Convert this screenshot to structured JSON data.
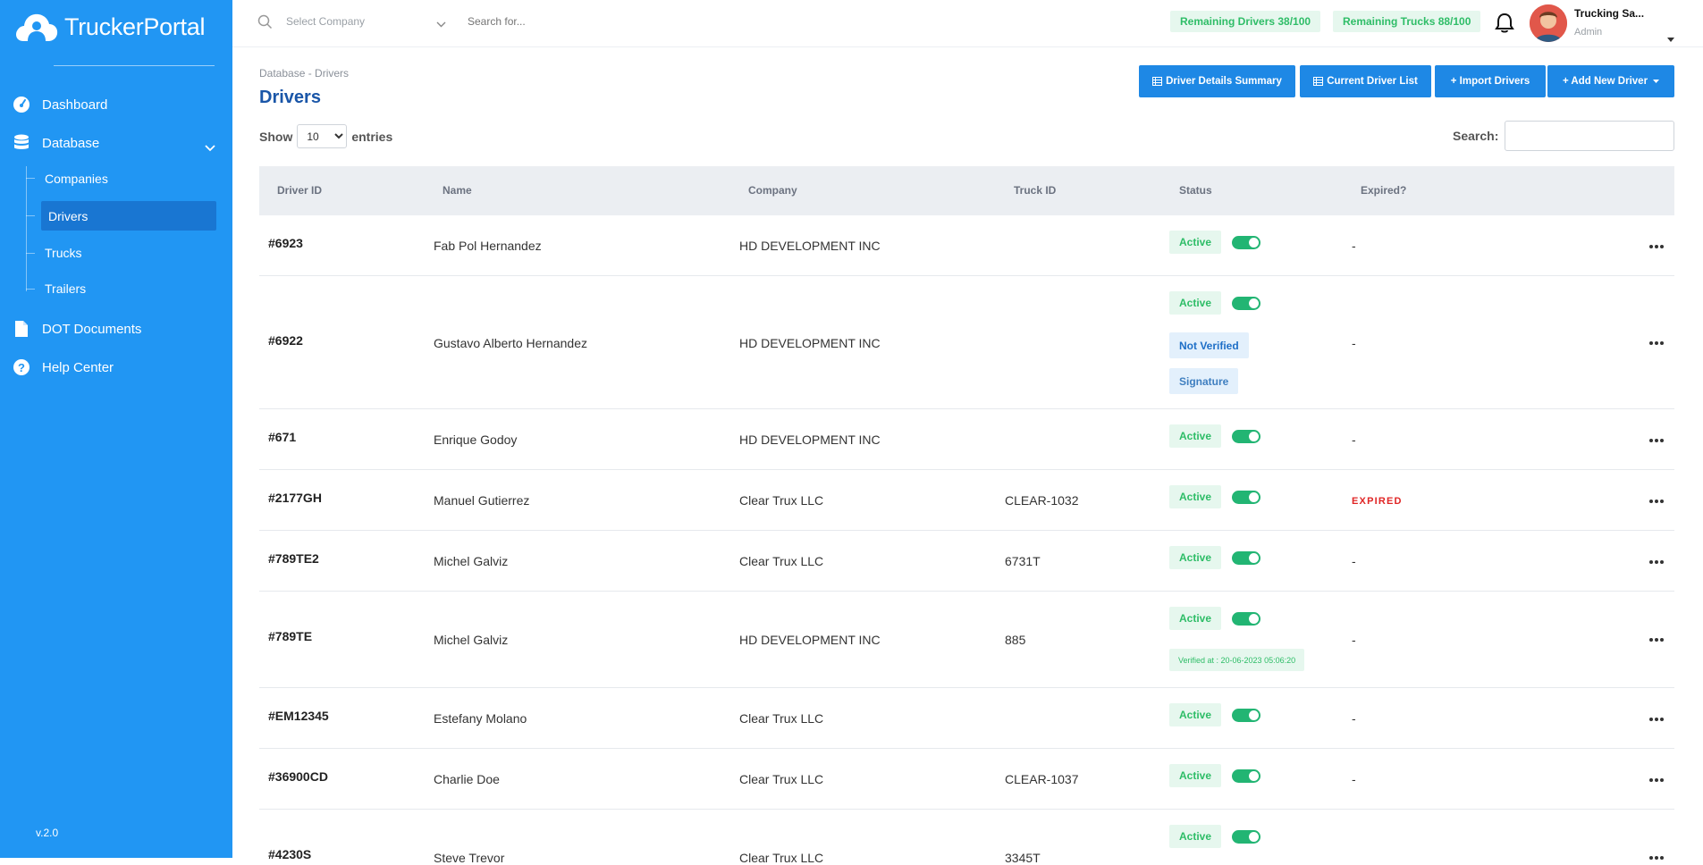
{
  "app": {
    "logo_text": "TruckerPortal",
    "version": "v.2.0"
  },
  "sidebar": {
    "items": [
      {
        "label": "Dashboard",
        "icon": "dashboard-gauge-icon"
      },
      {
        "label": "Database",
        "icon": "database-icon"
      },
      {
        "label": "DOT Documents",
        "icon": "document-icon"
      },
      {
        "label": "Help Center",
        "icon": "help-icon"
      }
    ],
    "subitems": [
      {
        "label": "Companies"
      },
      {
        "label": "Drivers",
        "active": true
      },
      {
        "label": "Trucks"
      },
      {
        "label": "Trailers"
      }
    ]
  },
  "topbar": {
    "select_company_placeholder": "Select Company",
    "search_placeholder": "Search for...",
    "remaining_drivers": "Remaining Drivers 38/100",
    "remaining_trucks": "Remaining Trucks 88/100",
    "user_name": "Trucking Sa...",
    "user_role": "Admin"
  },
  "page": {
    "breadcrumb": "Database - Drivers",
    "title": "Drivers",
    "buttons": {
      "summary": "Driver Details Summary",
      "current": "Current Driver List",
      "import": "+ Import Drivers",
      "add": "+ Add New Driver"
    },
    "show_label": "Show",
    "entries_label": "entries",
    "entries_value": "10",
    "search_label": "Search:"
  },
  "table": {
    "columns": [
      "Driver ID",
      "Name",
      "Company",
      "Truck ID",
      "Status",
      "Expired?"
    ],
    "rows": [
      {
        "id": "#6923",
        "name": "Fab Pol Hernandez",
        "company": "HD DEVELOPMENT INC",
        "truck": "",
        "status": "Active",
        "expired": "-"
      },
      {
        "id": "#6922",
        "name": "Gustavo Alberto Hernandez",
        "company": "HD DEVELOPMENT INC",
        "truck": "",
        "status": "Active",
        "extra1": "Not Verified",
        "extra2": "Signature",
        "expired": "-"
      },
      {
        "id": "#671",
        "name": "Enrique Godoy",
        "company": "HD DEVELOPMENT INC",
        "truck": "",
        "status": "Active",
        "expired": "-"
      },
      {
        "id": "#2177GH",
        "name": "Manuel Gutierrez",
        "company": "Clear Trux LLC",
        "truck": "CLEAR-1032",
        "status": "Active",
        "expired": "EXPIRED"
      },
      {
        "id": "#789TE2",
        "name": "Michel Galviz",
        "company": "Clear Trux LLC",
        "truck": "6731T",
        "status": "Active",
        "expired": "-"
      },
      {
        "id": "#789TE",
        "name": "Michel Galviz",
        "company": "HD DEVELOPMENT INC",
        "truck": "885",
        "status": "Active",
        "verified": "Verified at : 20-06-2023 05:06:20",
        "expired": "-"
      },
      {
        "id": "#EM12345",
        "name": "Estefany Molano",
        "company": "Clear Trux LLC",
        "truck": "",
        "status": "Active",
        "expired": "-"
      },
      {
        "id": "#36900CD",
        "name": "Charlie Doe",
        "company": "Clear Trux LLC",
        "truck": "CLEAR-1037",
        "status": "Active",
        "expired": "-"
      },
      {
        "id": "#4230S",
        "name": "Steve Trevor",
        "company": "Clear Trux LLC",
        "truck": "3345T",
        "status": "Active",
        "expired": "-"
      }
    ]
  },
  "colors": {
    "sidebar": "#2196f3",
    "accent": "#1e88e5",
    "success": "#2ebd67",
    "danger": "#e02424",
    "title": "#1a56a8"
  }
}
